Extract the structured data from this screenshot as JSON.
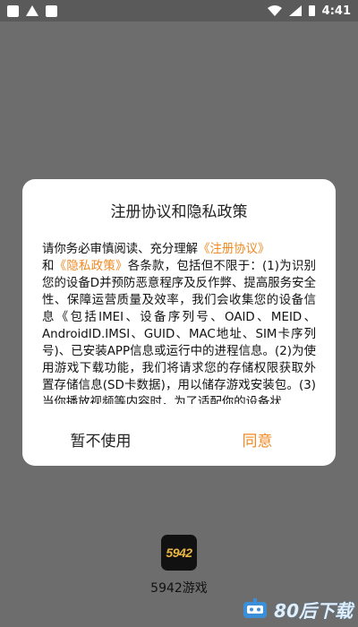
{
  "status_bar": {
    "time": "4:41"
  },
  "dialog": {
    "title": "注册协议和隐私政策",
    "intro_1": "请你务必审慎阅读、充分理解",
    "link_register": "《注册协议》",
    "and": "和",
    "link_privacy": "《隐私政策》",
    "body_rest": "各条款，包括但不限于：(1)为识别您的设备D并预防恶意程序及反作弊、提高服务安全性、保障运营质量及效率，我们会收集您的设备信息《包括IMEI、设备序列号、OAID、MEID、AndroidID.IMSI、GUID、MAC地址、SIM卡序列号)、已安装APP信息或运行中的进程信息。(2)为使用游戏下载功能，我们将请求您的存储权限获取外置存储信息(SD卡数据)，用以储存游戏安装包。(3)当你播放视频等内容时，为了适配你的设备状",
    "decline_label": "暂不使用",
    "agree_label": "同意"
  },
  "app": {
    "logo_text": "5942",
    "name": "5942游戏"
  },
  "watermark": {
    "text": "80后下载"
  },
  "colors": {
    "accent": "#f08a24",
    "overlay": "#6d6d6d"
  }
}
